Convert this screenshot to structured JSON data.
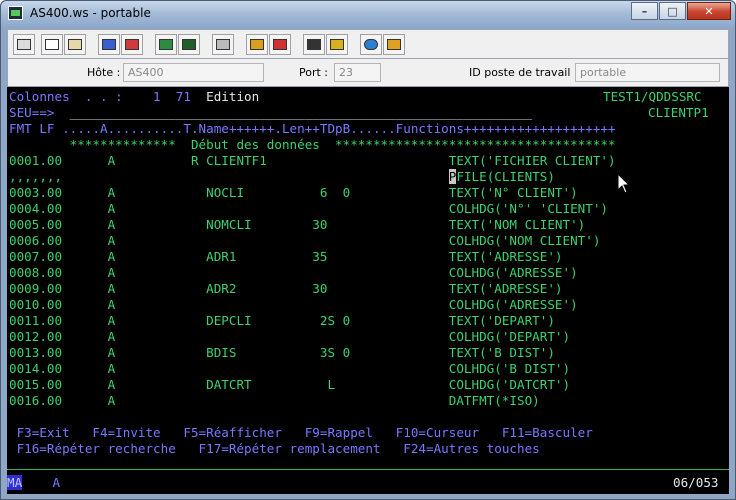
{
  "window": {
    "title": "AS400.ws - portable",
    "minimize": "–",
    "maximize": "□",
    "close": "✕"
  },
  "toolbar": {
    "buttons": [
      "print-screen",
      "copy",
      "paste",
      "send",
      "receive",
      "display",
      "macro",
      "keyboard",
      "record",
      "play",
      "rec-macro",
      "play-macro",
      "web",
      "edit"
    ]
  },
  "connection": {
    "host_label": "Hôte :",
    "host_value": "AS400",
    "port_label": "Port :",
    "port_value": "23",
    "workstation_label": "ID poste de travail :",
    "workstation_value": "portable"
  },
  "screen": {
    "line1": {
      "left": "Colonnes  . . :    1  71  ",
      "mode": "Edition",
      "right": "TEST1/QDDSSRC"
    },
    "line2": {
      "left": "SEU==>  ",
      "field": "_____________________________________________________________",
      "right": "CLIENTP1"
    },
    "line3": "FMT LF .....A..........T.Name++++++.Len++TDpB......Functions++++++++++++++++++++",
    "line4": "        **************  Début des données  *************************************",
    "rows": [
      {
        "seq": "0001.00",
        "text": "      A          R CLIENTF1                        ",
        "func": "TEXT('FICHIER CLIENT')"
      },
      {
        "seq": ",,,,,,,",
        "text": "                                                   ",
        "cursor": "P",
        "func": "FILE(CLIENTS)"
      },
      {
        "seq": "0003.00",
        "text": "      A            NOCLI          6  0             ",
        "func": "TEXT('N° CLIENT')"
      },
      {
        "seq": "0004.00",
        "text": "      A                                            ",
        "func": "COLHDG('N°' 'CLIENT')"
      },
      {
        "seq": "0005.00",
        "text": "      A            NOMCLI        30                ",
        "func": "TEXT('NOM CLIENT')"
      },
      {
        "seq": "0006.00",
        "text": "      A                                            ",
        "func": "COLHDG('NOM CLIENT')"
      },
      {
        "seq": "0007.00",
        "text": "      A            ADR1          35                ",
        "func": "TEXT('ADRESSE')"
      },
      {
        "seq": "0008.00",
        "text": "      A                                            ",
        "func": "COLHDG('ADRESSE')"
      },
      {
        "seq": "0009.00",
        "text": "      A            ADR2          30                ",
        "func": "TEXT('ADRESSE')"
      },
      {
        "seq": "0010.00",
        "text": "      A                                            ",
        "func": "COLHDG('ADRESSE')"
      },
      {
        "seq": "0011.00",
        "text": "      A            DEPCLI         2S 0             ",
        "func": "TEXT('DEPART')"
      },
      {
        "seq": "0012.00",
        "text": "      A                                            ",
        "func": "COLHDG('DEPART')"
      },
      {
        "seq": "0013.00",
        "text": "      A            BDIS           3S 0             ",
        "func": "TEXT('B DIST')"
      },
      {
        "seq": "0014.00",
        "text": "      A                                            ",
        "func": "COLHDG('B DIST')"
      },
      {
        "seq": "0015.00",
        "text": "      A            DATCRT          L               ",
        "func": "COLHDG('DATCRT')"
      },
      {
        "seq": "0016.00",
        "text": "      A                                            ",
        "func": "DATFMT(*ISO)"
      }
    ],
    "fkeys_line1": " F3=Exit   F4=Invite   F5=Réafficher   F9=Rappel   F10=Curseur   F11=Basculer",
    "fkeys_line2": " F16=Répéter recherche   F17=Répéter remplacement   F24=Autres touches"
  },
  "status": {
    "mode": "MA",
    "indicator": "A",
    "position": "06/053"
  },
  "colors": {
    "green": "#3cd26c",
    "blue": "#7878ff",
    "white": "#e8e8e8",
    "background": "#000000"
  }
}
